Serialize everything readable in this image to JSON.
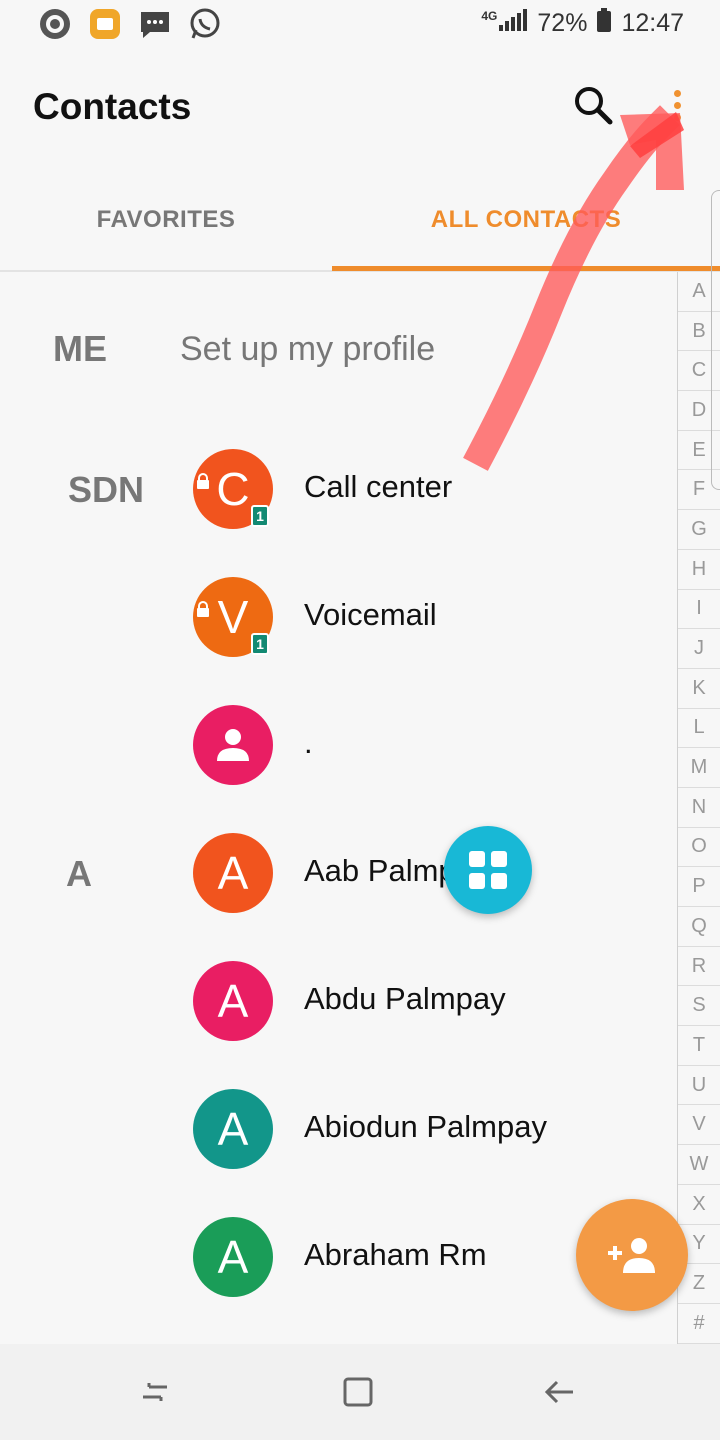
{
  "status_bar": {
    "network": "4G",
    "battery": "72%",
    "time": "12:47"
  },
  "app_bar": {
    "title": "Contacts"
  },
  "tabs": [
    {
      "label": "FAVORITES"
    },
    {
      "label": "ALL CONTACTS"
    }
  ],
  "me": {
    "label": "ME",
    "text": "Set up my profile"
  },
  "contacts": [
    {
      "section": "SDN",
      "initial": "C",
      "name": "Call center",
      "color": "#f1541e",
      "sim": "1"
    },
    {
      "section": "",
      "initial": "V",
      "name": "Voicemail",
      "color": "#ee6a12",
      "sim": "1"
    },
    {
      "section": "",
      "initial": "",
      "name": ".",
      "color": "#e91e63"
    },
    {
      "section": "A",
      "initial": "A",
      "name": "Aab Palmpay",
      "color": "#f1541e"
    },
    {
      "section": "",
      "initial": "A",
      "name": "Abdu Palmpay",
      "color": "#e91e63"
    },
    {
      "section": "",
      "initial": "A",
      "name": "Abiodun Palmpay",
      "color": "#12968a"
    },
    {
      "section": "",
      "initial": "A",
      "name": "Abraham Rm",
      "color": "#1a9d58"
    }
  ],
  "index": [
    "A",
    "B",
    "C",
    "D",
    "E",
    "F",
    "G",
    "H",
    "I",
    "J",
    "K",
    "L",
    "M",
    "N",
    "O",
    "P",
    "Q",
    "R",
    "S",
    "T",
    "U",
    "V",
    "W",
    "X",
    "Y",
    "Z",
    "#"
  ],
  "colors": {
    "accent": "#ef8c2c",
    "grid_fab": "#18b8d6",
    "add_fab": "#f39a45"
  }
}
